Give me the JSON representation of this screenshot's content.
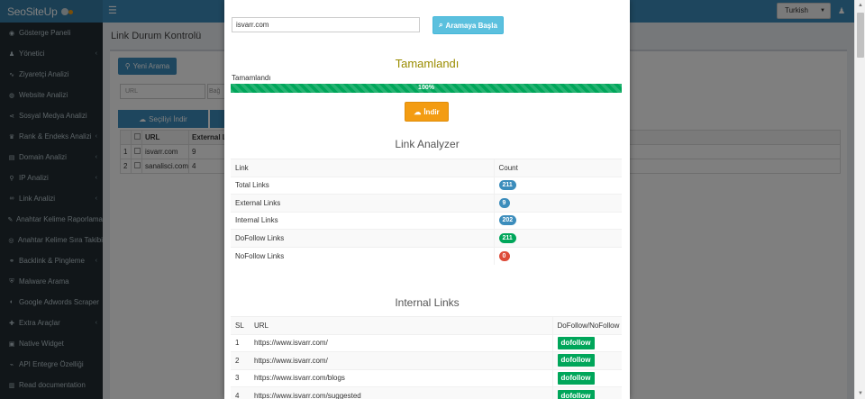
{
  "app": {
    "logo": "SeoSiteUp",
    "language": "Turkish"
  },
  "sidebar": {
    "items": [
      {
        "label": "Gösterge Paneli",
        "icon": "dashboard-icon",
        "glyph": "◉",
        "arrow": ""
      },
      {
        "label": "Yönetici",
        "icon": "users-icon",
        "glyph": "♟",
        "arrow": "‹"
      },
      {
        "label": "Ziyaretçi Analizi",
        "icon": "chart-line-icon",
        "glyph": "∿",
        "arrow": ""
      },
      {
        "label": "Website Analizi",
        "icon": "globe-icon",
        "glyph": "◍",
        "arrow": ""
      },
      {
        "label": "Sosyal Medya Analizi",
        "icon": "share-icon",
        "glyph": "⋖",
        "arrow": ""
      },
      {
        "label": "Rank & Endeks Analizi",
        "icon": "trophy-icon",
        "glyph": "♛",
        "arrow": "‹"
      },
      {
        "label": "Domain Analizi",
        "icon": "server-icon",
        "glyph": "▤",
        "arrow": "‹"
      },
      {
        "label": "IP Analizi",
        "icon": "map-marker-icon",
        "glyph": "⚲",
        "arrow": "‹"
      },
      {
        "label": "Link Analizi",
        "icon": "link-icon",
        "glyph": "∞",
        "arrow": "‹"
      },
      {
        "label": "Anahtar Kelime Raporlama",
        "icon": "tags-icon",
        "glyph": "✎",
        "arrow": ""
      },
      {
        "label": "Anahtar Kelime Sıra Takibi",
        "icon": "eye-icon",
        "glyph": "◎",
        "arrow": ""
      },
      {
        "label": "Backlink & Pingleme",
        "icon": "backlink-icon",
        "glyph": "⚭",
        "arrow": "‹"
      },
      {
        "label": "Malware Arama",
        "icon": "shield-icon",
        "glyph": "⛨",
        "arrow": ""
      },
      {
        "label": "Google Adwords Scraper",
        "icon": "google-icon",
        "glyph": "◐",
        "arrow": ""
      },
      {
        "label": "Extra Araçlar",
        "icon": "plug-icon",
        "glyph": "✚",
        "arrow": "‹"
      },
      {
        "label": "Native Widget",
        "icon": "widget-icon",
        "glyph": "▣",
        "arrow": ""
      },
      {
        "label": "API Entegre Özelliği",
        "icon": "api-icon",
        "glyph": "⌁",
        "arrow": ""
      },
      {
        "label": "Read documentation",
        "icon": "book-icon",
        "glyph": "▥",
        "arrow": ""
      }
    ]
  },
  "background_page": {
    "title": "Link Durum Kontrolü",
    "new_search_label": "Yeni Arama",
    "url_placeholder": "URL",
    "second_input_partial": "Bağ",
    "download_selected_label": "Seçiliyi İndir",
    "table": {
      "headers": [
        "",
        "",
        "URL",
        "External L"
      ],
      "rows": [
        [
          "1",
          "",
          "isvarr.com",
          "9"
        ],
        [
          "2",
          "",
          "sanalisci.com",
          "4"
        ]
      ]
    }
  },
  "modal": {
    "url_value": "isvarr.com",
    "search_button": "Aramaya Başla",
    "status_title": "Tamamlandı",
    "progress_label": "Tamamlandı",
    "progress_percent": 100,
    "progress_text": "100%",
    "download_button": "İndir",
    "colors": {
      "success": "#00a65a",
      "info": "#5bc0de",
      "warning": "#f39c12",
      "primary": "#3c8dbc",
      "danger": "#dd4b39"
    },
    "analyzer": {
      "title": "Link Analyzer",
      "headers": [
        "Link",
        "Count"
      ],
      "rows": [
        {
          "label": "Total Links",
          "count": "211",
          "color": "blue"
        },
        {
          "label": "External Links",
          "count": "9",
          "color": "blue"
        },
        {
          "label": "Internal Links",
          "count": "202",
          "color": "blue"
        },
        {
          "label": "DoFollow Links",
          "count": "211",
          "color": "green"
        },
        {
          "label": "NoFollow Links",
          "count": "0",
          "color": "red"
        }
      ]
    },
    "internal": {
      "title": "Internal Links",
      "headers": [
        "SL",
        "URL",
        "DoFollow/NoFollow"
      ],
      "rows": [
        {
          "sl": "1",
          "url": "https://www.isvarr.com/",
          "follow": "dofollow"
        },
        {
          "sl": "2",
          "url": "https://www.isvarr.com/",
          "follow": "dofollow"
        },
        {
          "sl": "3",
          "url": "https://www.isvarr.com/blogs",
          "follow": "dofollow"
        },
        {
          "sl": "4",
          "url": "https://www.isvarr.com/suggested",
          "follow": "dofollow"
        }
      ]
    }
  }
}
